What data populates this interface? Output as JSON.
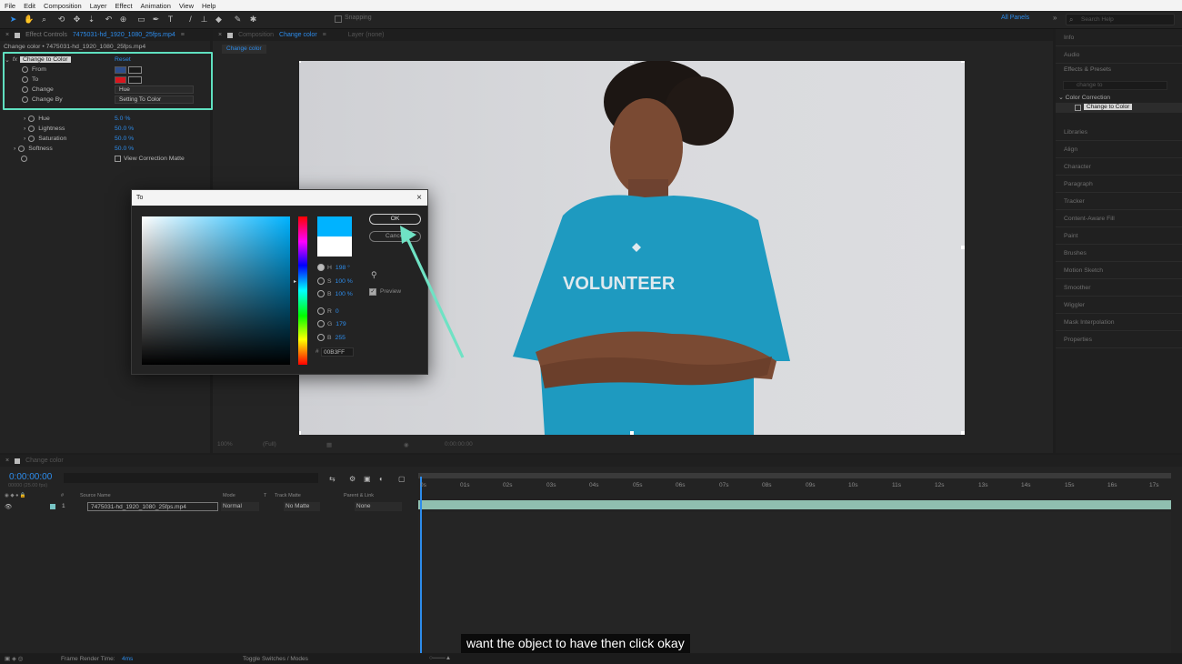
{
  "menu": [
    "File",
    "Edit",
    "Composition",
    "Layer",
    "Effect",
    "Animation",
    "View",
    "Help"
  ],
  "toolbar": {
    "snapping_label": "Snapping",
    "workspace_label": "All Panels",
    "search_placeholder": "Search Help"
  },
  "effect_controls": {
    "tab_label": "Effect Controls",
    "tab_file": "7475031-hd_1920_1080_25fps.mp4",
    "breadcrumb": "Change color • 7475031-hd_1920_1080_25fps.mp4",
    "effect_name": "Change to Color",
    "reset_label": "Reset",
    "props": {
      "from": "From",
      "to": "To",
      "change": "Change",
      "change_value": "Hue",
      "change_by": "Change By",
      "change_by_value": "Setting To Color",
      "hue": "Hue",
      "hue_value": "5.0 %",
      "lightness": "Lightness",
      "lightness_value": "50.0 %",
      "saturation": "Saturation",
      "saturation_value": "50.0 %",
      "softness": "Softness",
      "softness_value": "50.0 %",
      "matte": "View Correction Matte"
    },
    "from_color": "#2e4e8c",
    "to_color": "#d9161e"
  },
  "composition": {
    "tab_label": "Composition",
    "tab_name": "Change color",
    "layer_tab": "Layer (none)",
    "sub_tab": "Change color",
    "shirt_text": "VOLUNTEER"
  },
  "viewer_bar": {
    "zoom": "(Full)",
    "time": "0:00:00:00",
    "camera": "Active Camera",
    "views": "1 View"
  },
  "right_panel": {
    "items_top": [
      "Info",
      "Audio",
      "Effects & Presets"
    ],
    "search_value": "change to",
    "folder": "Color Correction",
    "selected": "Change to Color",
    "items": [
      "Libraries",
      "Align",
      "Character",
      "Paragraph",
      "Tracker",
      "Content-Aware Fill",
      "Paint",
      "Brushes",
      "Motion Sketch",
      "Smoother",
      "Wiggler",
      "Mask Interpolation",
      "Properties"
    ]
  },
  "dialog": {
    "title": "To",
    "ok": "OK",
    "cancel": "Cancel",
    "h_label": "H",
    "h_value": "198 °",
    "s_label": "S",
    "s_value": "100 %",
    "b_label": "B",
    "b_value": "100 %",
    "r_label": "R",
    "r_value": "0",
    "g_label": "G",
    "g_value": "179",
    "bl_label": "B",
    "bl_value": "255",
    "hex_prefix": "#",
    "hex": "00B3FF",
    "preview_label": "Preview",
    "new_color": "#00b3ff",
    "old_color": "#ffffff"
  },
  "timeline": {
    "tab_label": "Change color",
    "timecode": "0:00:00:00",
    "fps": "00000 (25.00 fps)",
    "cols": {
      "source": "Source Name",
      "mode": "Mode",
      "t": "T",
      "track": "Track Matte",
      "parent": "Parent & Link"
    },
    "layer": {
      "num": "1",
      "name": "7475031-hd_1920_1080_25fps.mp4",
      "mode": "Normal",
      "matte": "No Matte",
      "parent": "None"
    },
    "ticks": [
      "0s",
      "01s",
      "02s",
      "03s",
      "04s",
      "05s",
      "06s",
      "07s",
      "08s",
      "09s",
      "10s",
      "11s",
      "12s",
      "13s",
      "14s",
      "15s",
      "16s",
      "17s"
    ]
  },
  "status": {
    "render_label": "Frame Render Time:",
    "render_value": "4ms",
    "toggle": "Toggle Switches / Modes"
  },
  "caption": "want the object to have then click okay",
  "colors": {
    "highlight": "#5fe0c0",
    "accent_blue": "#2d8ceb",
    "arrow": "#6fe2c4"
  }
}
